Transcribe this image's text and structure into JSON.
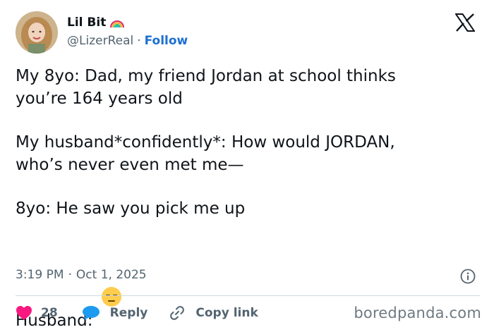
{
  "author": {
    "display_name": "Lil Bit",
    "name_emoji_icon": "rainbow-icon",
    "handle": "@LizerReal",
    "separator": "·",
    "follow_label": "Follow"
  },
  "platform_icon": "x-logo-icon",
  "tweet": {
    "paragraphs": [
      "My 8yo: Dad, my friend Jordan at school thinks\nyou’re 164 years old",
      "My husband*confidently*: How would JORDAN,\nwho’s never even met me—",
      "8yo: He saw you pick me up",
      "Husband: "
    ],
    "closing_emoji_icon": "expressionless-face-icon"
  },
  "meta": {
    "time": "3:19 PM",
    "separator": "·",
    "date": "Oct 1, 2025",
    "info_icon": "info-icon"
  },
  "actions": {
    "like_count": "28",
    "reply_label": "Reply",
    "copy_link_label": "Copy link"
  },
  "watermark": "boredpanda.com",
  "colors": {
    "like_red": "#f91880",
    "link_blue": "#1d6fd1",
    "secondary_gray": "#536471"
  }
}
